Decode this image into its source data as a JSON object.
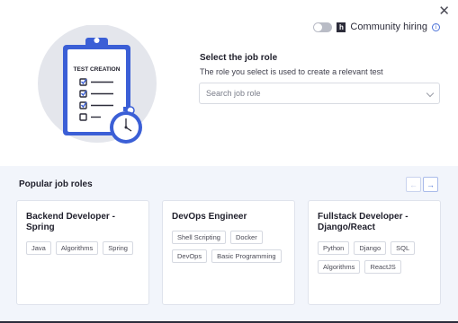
{
  "header": {
    "toggle_state": "off",
    "community_logo": "h",
    "community_label": "Community hiring",
    "info_icon": "i"
  },
  "illustration": {
    "clipboard_title": "TEST CREATION"
  },
  "job_role": {
    "title": "Select the job role",
    "subtitle": "The role you select is used to create a relevant test",
    "search_placeholder": "Search job role",
    "search_value": ""
  },
  "popular": {
    "title": "Popular job roles",
    "prev_label": "←",
    "next_label": "→",
    "cards": [
      {
        "title": "Backend Developer - Spring",
        "skills": [
          "Java",
          "Algorithms",
          "Spring"
        ]
      },
      {
        "title": "DevOps Engineer",
        "skills": [
          "Shell Scripting",
          "Docker",
          "DevOps",
          "Basic Programming"
        ]
      },
      {
        "title": "Fullstack Developer - Django/React",
        "skills": [
          "Python",
          "Django",
          "SQL",
          "Algorithms",
          "ReactJS"
        ]
      }
    ]
  },
  "colors": {
    "accent": "#4d73d8",
    "bottom_bg": "#f2f5fb",
    "illustration_circle": "#e4e6ec"
  },
  "icons": {
    "close": "close-icon",
    "toggle": "toggle-switch",
    "logo": "hackerearth-logo-icon",
    "info": "info-icon",
    "chevron": "chevron-down-icon",
    "prev": "arrow-left-icon",
    "next": "arrow-right-icon"
  }
}
